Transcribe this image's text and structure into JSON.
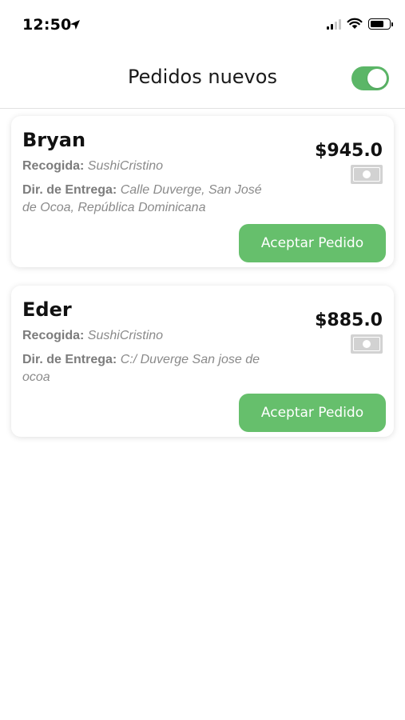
{
  "status_bar": {
    "time": "12:50",
    "location_icon": "location-arrow-icon",
    "signal_icon": "cellular-signal-icon",
    "wifi_icon": "wifi-icon",
    "battery_icon": "battery-icon"
  },
  "header": {
    "title": "Pedidos nuevos",
    "toggle_on": true,
    "toggle_color": "#5bb667"
  },
  "labels": {
    "pickup": "Recogida:",
    "delivery": "Dir. de Entrega:"
  },
  "orders": [
    {
      "name": "Bryan",
      "price": "$945.0",
      "pickup_place": "SushiCristino",
      "delivery_address": "Calle Duverge, San José de Ocoa, República Dominicana",
      "payment_icon": "cash-icon",
      "accept_label": "Aceptar Pedido"
    },
    {
      "name": "Eder",
      "price": "$885.0",
      "pickup_place": "SushiCristino",
      "delivery_address": "C:/ Duverge San jose de ocoa",
      "payment_icon": "cash-icon",
      "accept_label": "Aceptar Pedido"
    }
  ],
  "colors": {
    "accent": "#66bf6c",
    "muted_text": "#888888"
  }
}
